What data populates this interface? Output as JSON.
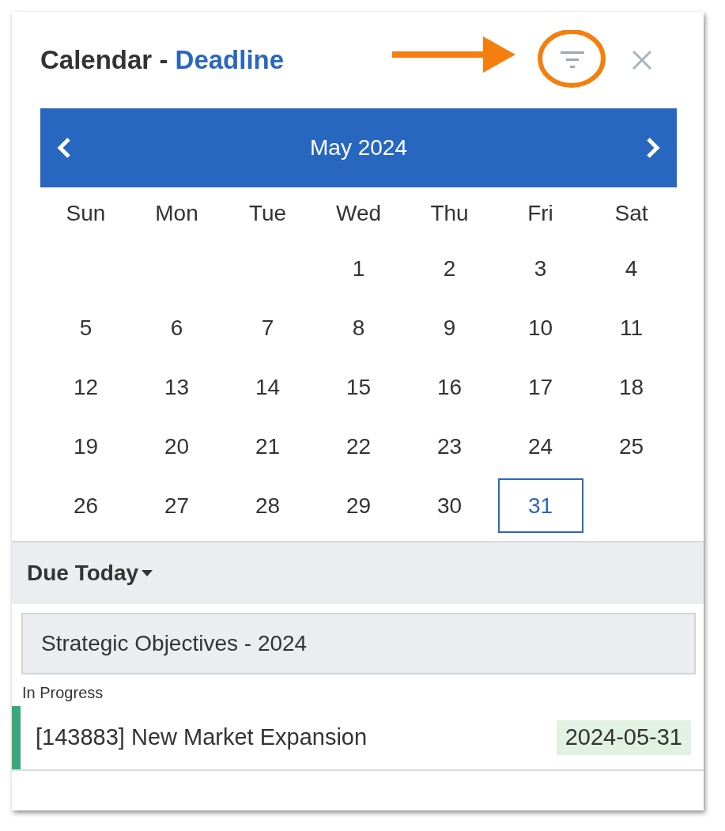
{
  "header": {
    "title": "Calendar - ",
    "title_highlight": "Deadline"
  },
  "calendar": {
    "month": "May 2024",
    "weekdays": [
      "Sun",
      "Mon",
      "Tue",
      "Wed",
      "Thu",
      "Fri",
      "Sat"
    ],
    "weeks": [
      {
        "kind": "first",
        "days": [
          {
            "label": "1",
            "selected": false
          },
          {
            "label": "2",
            "selected": false
          },
          {
            "label": "3",
            "selected": false
          },
          {
            "label": "4",
            "selected": false
          }
        ]
      },
      {
        "kind": "full",
        "days": [
          {
            "label": "5",
            "selected": false
          },
          {
            "label": "6",
            "selected": false
          },
          {
            "label": "7",
            "selected": false
          },
          {
            "label": "8",
            "selected": false
          },
          {
            "label": "9",
            "selected": false
          },
          {
            "label": "10",
            "selected": false
          },
          {
            "label": "11",
            "selected": false
          }
        ]
      },
      {
        "kind": "full",
        "days": [
          {
            "label": "12",
            "selected": false
          },
          {
            "label": "13",
            "selected": false
          },
          {
            "label": "14",
            "selected": false
          },
          {
            "label": "15",
            "selected": false
          },
          {
            "label": "16",
            "selected": false
          },
          {
            "label": "17",
            "selected": false
          },
          {
            "label": "18",
            "selected": false
          }
        ]
      },
      {
        "kind": "full",
        "days": [
          {
            "label": "19",
            "selected": false
          },
          {
            "label": "20",
            "selected": false
          },
          {
            "label": "21",
            "selected": false
          },
          {
            "label": "22",
            "selected": false
          },
          {
            "label": "23",
            "selected": false
          },
          {
            "label": "24",
            "selected": false
          },
          {
            "label": "25",
            "selected": false
          }
        ]
      },
      {
        "kind": "last",
        "days": [
          {
            "label": "26",
            "selected": false
          },
          {
            "label": "27",
            "selected": false
          },
          {
            "label": "28",
            "selected": false
          },
          {
            "label": "29",
            "selected": false
          },
          {
            "label": "30",
            "selected": false
          },
          {
            "label": "31",
            "selected": true
          }
        ]
      }
    ]
  },
  "due": {
    "heading": "Due Today",
    "groups": [
      {
        "title": "Strategic Objectives - 2024",
        "status": "In Progress",
        "items": [
          {
            "text": "[143883] New Market Expansion",
            "date": "2024-05-31",
            "color": "#3aa87a"
          }
        ]
      }
    ]
  }
}
